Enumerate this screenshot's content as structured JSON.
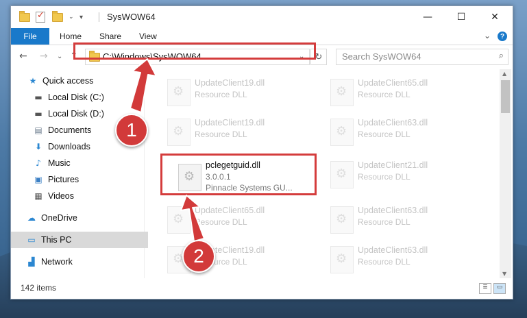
{
  "window": {
    "title": "SysWOW64"
  },
  "window_buttons": {
    "minimize": "—",
    "maximize": "☐",
    "close": "✕"
  },
  "ribbon": {
    "file": "File",
    "home": "Home",
    "share": "Share",
    "view": "View",
    "expand": "⌄",
    "help": "?"
  },
  "nav": {
    "back": "←",
    "forward": "→",
    "recent": "⌄",
    "up": "↑",
    "refresh": "↻"
  },
  "address": {
    "path": "C:\\Windows\\SysWOW64",
    "dropdown": "⌄"
  },
  "search": {
    "placeholder": "Search SysWOW64",
    "icon": "⌕"
  },
  "sidebar": {
    "items": [
      {
        "label": "Quick access",
        "icon": "★",
        "icon_color": "#2b87d1",
        "pinned": false
      },
      {
        "label": "Local Disk (C:)",
        "icon": "▬",
        "icon_color": "#555555",
        "pinned": true
      },
      {
        "label": "Local Disk (D:)",
        "icon": "▬",
        "icon_color": "#555555",
        "pinned": true
      },
      {
        "label": "Documents",
        "icon": "▤",
        "icon_color": "#6b7b8c",
        "pinned": true
      },
      {
        "label": "Downloads",
        "icon": "⬇",
        "icon_color": "#2b87d1",
        "pinned": true
      },
      {
        "label": "Music",
        "icon": "♪",
        "icon_color": "#2b87d1",
        "pinned": true
      },
      {
        "label": "Pictures",
        "icon": "▣",
        "icon_color": "#3b7fc4",
        "pinned": true
      },
      {
        "label": "Videos",
        "icon": "▦",
        "icon_color": "#555555",
        "pinned": true
      },
      {
        "label": "OneDrive",
        "icon": "☁",
        "icon_color": "#2b87d1",
        "pinned": false
      },
      {
        "label": "This PC",
        "icon": "▭",
        "icon_color": "#2b87d1",
        "pinned": false,
        "selected": true
      },
      {
        "label": "Network",
        "icon": "▟",
        "icon_color": "#2b87d1",
        "pinned": false
      }
    ],
    "pin_icon": "📌"
  },
  "files": [
    {
      "name": "UpdateClient19.dll",
      "type": "Resource DLL",
      "dim": true
    },
    {
      "name": "UpdateClient65.dll",
      "type": "Resource DLL",
      "dim": true
    },
    {
      "name": "UpdateClient19.dll",
      "type": "Resource DLL",
      "dim": true
    },
    {
      "name": "UpdateClient63.dll",
      "type": "Resource DLL",
      "dim": true
    },
    {
      "name": "pclegetguid.dll",
      "type": "3.0.0.1",
      "company": "Pinnacle Systems GU...",
      "dim": false
    },
    {
      "name": "UpdateClient21.dll",
      "type": "Resource DLL",
      "dim": true
    },
    {
      "name": "UpdateClient65.dll",
      "type": "Resource DLL",
      "dim": true
    },
    {
      "name": "UpdateClient63.dll",
      "type": "Resource DLL",
      "dim": true
    },
    {
      "name": "UpdateClient19.dll",
      "type": "Resource DLL",
      "dim": true
    },
    {
      "name": "UpdateClient63.dll",
      "type": "Resource DLL",
      "dim": true
    }
  ],
  "status": {
    "items": "142 items",
    "details_view": "≣",
    "tiles_view": "▭"
  },
  "annotations": {
    "step1": "1",
    "step2": "2",
    "color": "#d23a3a"
  }
}
